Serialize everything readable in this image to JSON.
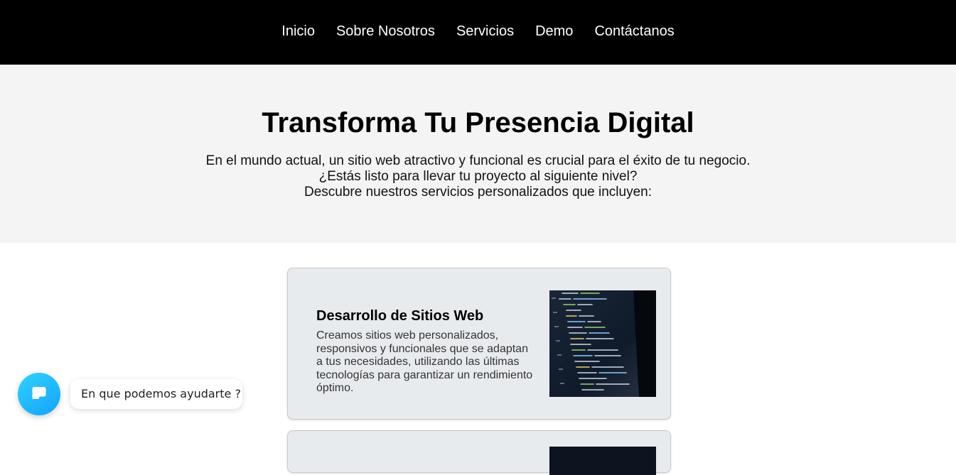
{
  "nav": {
    "items": [
      {
        "label": "Inicio"
      },
      {
        "label": "Sobre Nosotros"
      },
      {
        "label": "Servicios"
      },
      {
        "label": "Demo"
      },
      {
        "label": "Contáctanos"
      }
    ]
  },
  "hero": {
    "title": "Transforma Tu Presencia Digital",
    "lines": [
      "En el mundo actual, un sitio web atractivo y funcional es crucial para el éxito de tu negocio.",
      "¿Estás listo para llevar tu proyecto al siguiente nivel?",
      "Descubre nuestros servicios personalizados que incluyen:"
    ]
  },
  "services": [
    {
      "title": "Desarrollo de Sitios Web",
      "description": "Creamos sitios web personalizados, responsivos y funcionales que se adaptan a tus necesidades, utilizando las últimas tecnologías para garantizar un rendimiento óptimo.",
      "image": "code-editor-screenshot"
    },
    {
      "title": "",
      "description": "",
      "image": "dark-screen-image"
    }
  ],
  "chat": {
    "icon": "chat-bubble-icon",
    "prompt": "En que podemos ayudarte ?"
  },
  "colors": {
    "navbar_bg": "#000000",
    "hero_bg": "#f4f4f4",
    "card_bg": "#e8ebee",
    "chat_accent": "#1fb8ff"
  }
}
